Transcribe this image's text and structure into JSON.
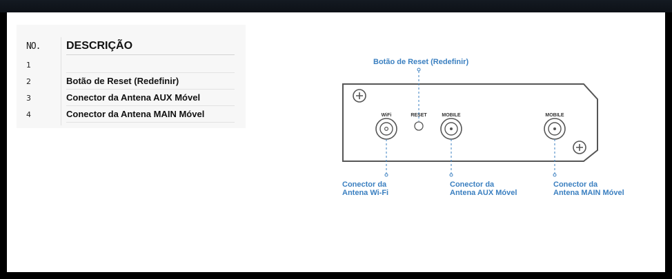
{
  "table": {
    "header_no": "NO.",
    "header_desc": "DESCRIÇÃO",
    "rows": [
      {
        "no": "1",
        "desc": ""
      },
      {
        "no": "2",
        "desc": "Botão de Reset (Redefinir)"
      },
      {
        "no": "3",
        "desc": "Conector da Antena AUX Móvel"
      },
      {
        "no": "4",
        "desc": "Conector da Antena MAIN Móvel"
      }
    ]
  },
  "diagram": {
    "port_labels": {
      "wifi": "WiFi",
      "reset": "RESET",
      "mobile_aux": "MOBILE",
      "mobile_main": "MOBILE"
    },
    "callouts": {
      "reset": "Botão de Reset (Redefinir)",
      "wifi_line1": "Conector da",
      "wifi_line2": "Antena Wi-Fi",
      "aux_line1": "Conector da",
      "aux_line2": "Antena AUX Móvel",
      "main_line1": "Conector da",
      "main_line2": "Antena MAIN Móvel"
    }
  },
  "colors": {
    "accent": "#3a7fc0",
    "frame": "#000000",
    "device_outline": "#555555"
  }
}
